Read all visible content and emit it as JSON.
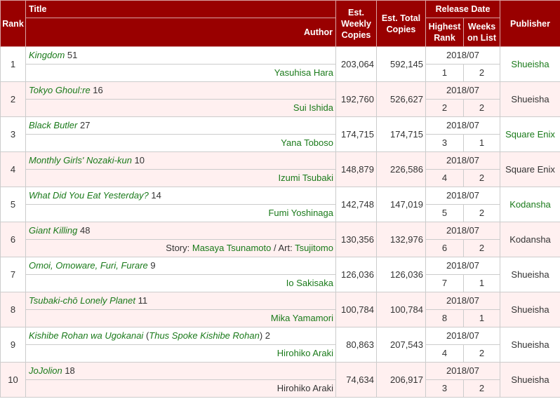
{
  "headers": {
    "rank": "Rank",
    "title": "Title",
    "author": "Author",
    "weekly": "Est. Weekly Copies",
    "total": "Est. Total Copies",
    "release_date": "Release Date",
    "highest_rank": "Highest Rank",
    "weeks_on_list": "Weeks on List",
    "publisher": "Publisher"
  },
  "rows": [
    {
      "rank": "1",
      "title": "Kingdom",
      "vol": " 51",
      "author": "Yasuhisa Hara",
      "weekly": "203,064",
      "total": "592,145",
      "date": "2018/07",
      "highest": "1",
      "weeks": "2",
      "publisher": "Shueisha",
      "pub_link": true
    },
    {
      "rank": "2",
      "title": "Tokyo Ghoul:re",
      "vol": " 16",
      "author": "Sui Ishida",
      "weekly": "192,760",
      "total": "526,627",
      "date": "2018/07",
      "highest": "2",
      "weeks": "2",
      "publisher": "Shueisha",
      "pub_link": false
    },
    {
      "rank": "3",
      "title": "Black Butler",
      "vol": " 27",
      "author": "Yana Toboso",
      "weekly": "174,715",
      "total": "174,715",
      "date": "2018/07",
      "highest": "3",
      "weeks": "1",
      "publisher": "Square Enix",
      "pub_link": true
    },
    {
      "rank": "4",
      "title": "Monthly Girls' Nozaki-kun",
      "vol": " 10",
      "author": "Izumi Tsubaki",
      "weekly": "148,879",
      "total": "226,586",
      "date": "2018/07",
      "highest": "4",
      "weeks": "2",
      "publisher": "Square Enix",
      "pub_link": false
    },
    {
      "rank": "5",
      "title": "What Did You Eat Yesterday?",
      "vol": " 14",
      "author": "Fumi Yoshinaga",
      "weekly": "142,748",
      "total": "147,019",
      "date": "2018/07",
      "highest": "5",
      "weeks": "2",
      "publisher": "Kodansha",
      "pub_link": true
    },
    {
      "rank": "6",
      "title": "Giant Killing",
      "vol": " 48",
      "author_prefix": "Story: ",
      "author": "Masaya Tsunamoto",
      "author_mid": " / Art: ",
      "author2": "Tsujitomo",
      "weekly": "130,356",
      "total": "132,976",
      "date": "2018/07",
      "highest": "6",
      "weeks": "2",
      "publisher": "Kodansha",
      "pub_link": false
    },
    {
      "rank": "7",
      "title": "Omoi, Omoware, Furi, Furare",
      "vol": " 9",
      "author": "Io Sakisaka",
      "weekly": "126,036",
      "total": "126,036",
      "date": "2018/07",
      "highest": "7",
      "weeks": "1",
      "publisher": "Shueisha",
      "pub_link": false
    },
    {
      "rank": "8",
      "title": "Tsubaki-chō Lonely Planet",
      "vol": " 11",
      "author": "Mika Yamamori",
      "weekly": "100,784",
      "total": "100,784",
      "date": "2018/07",
      "highest": "8",
      "weeks": "1",
      "publisher": "Shueisha",
      "pub_link": false
    },
    {
      "rank": "9",
      "title": "Kishibe Rohan wa Ugokanai",
      "title_paren_open": " (",
      "title_alt": "Thus Spoke Kishibe Rohan",
      "title_paren_close": ")",
      "vol": " 2",
      "author": "Hirohiko Araki",
      "weekly": "80,863",
      "total": "207,543",
      "date": "2018/07",
      "highest": "4",
      "weeks": "2",
      "publisher": "Shueisha",
      "pub_link": false
    },
    {
      "rank": "10",
      "title": "JoJolion",
      "vol": " 18",
      "author": "Hirohiko Araki",
      "author_plain": true,
      "weekly": "74,634",
      "total": "206,917",
      "date": "2018/07",
      "highest": "3",
      "weeks": "2",
      "publisher": "Shueisha",
      "pub_link": false
    }
  ]
}
